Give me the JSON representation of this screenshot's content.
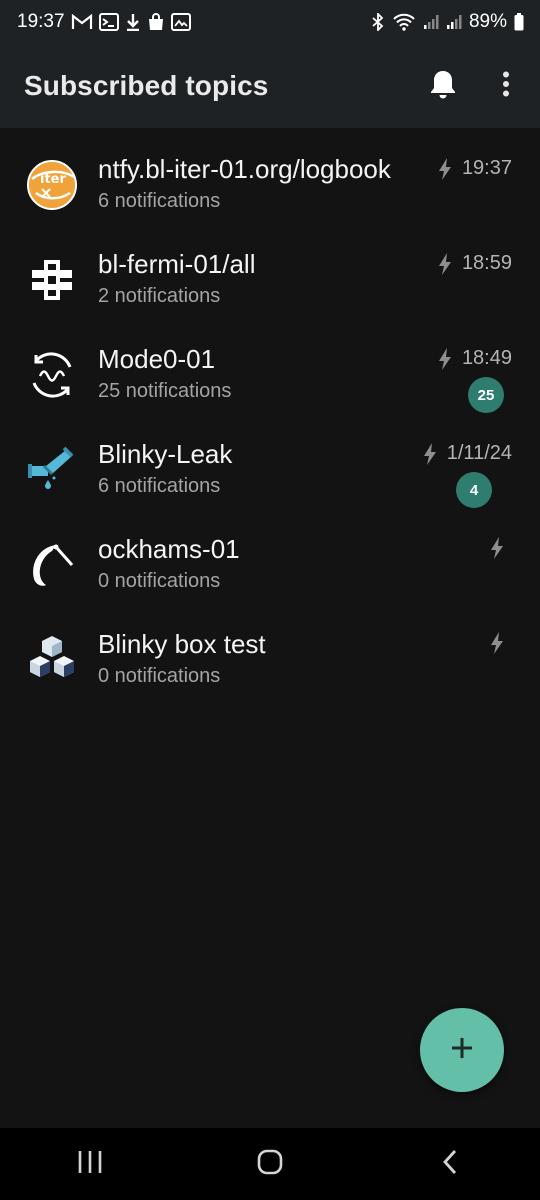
{
  "status_bar": {
    "time": "19:37",
    "battery_percent": "89%",
    "left_icons": [
      "gmail-icon",
      "terminal-icon",
      "download-icon",
      "shopping-bag-icon",
      "image-edit-icon"
    ],
    "right_icons": [
      "bluetooth-icon",
      "wifi-icon",
      "signal-icon",
      "signal-icon",
      "battery-icon"
    ]
  },
  "app_bar": {
    "title": "Subscribed topics",
    "actions": [
      "bell-icon",
      "more-vert-icon"
    ]
  },
  "topics": [
    {
      "title": "ntfy.bl-iter-01.org/logbook",
      "subtitle": "6 notifications",
      "time": "19:37",
      "unread": null,
      "icon": "iter-logo-icon"
    },
    {
      "title": "bl-fermi-01/all",
      "subtitle": "2 notifications",
      "time": "18:59",
      "unread": null,
      "icon": "fermilab-logo-icon"
    },
    {
      "title": "Mode0-01",
      "subtitle": "25 notifications",
      "time": "18:49",
      "unread": "25",
      "icon": "wave-cycle-icon"
    },
    {
      "title": "Blinky-Leak",
      "subtitle": "6 notifications",
      "time": "1/11/24",
      "unread": "4",
      "icon": "leaking-pipe-icon"
    },
    {
      "title": "ockhams-01",
      "subtitle": "0 notifications",
      "time": "",
      "unread": null,
      "icon": "razor-blade-icon"
    },
    {
      "title": "Blinky box test",
      "subtitle": "0 notifications",
      "time": "",
      "unread": null,
      "icon": "stacked-cubes-icon"
    }
  ],
  "colors": {
    "background": "#131313",
    "app_bar": "#1e2225",
    "accent": "#63bfa8",
    "badge": "#2f7d6f"
  },
  "fab": {
    "icon": "plus-icon"
  },
  "nav_bar": {
    "buttons": [
      "recent-apps-icon",
      "home-icon",
      "back-icon"
    ]
  }
}
